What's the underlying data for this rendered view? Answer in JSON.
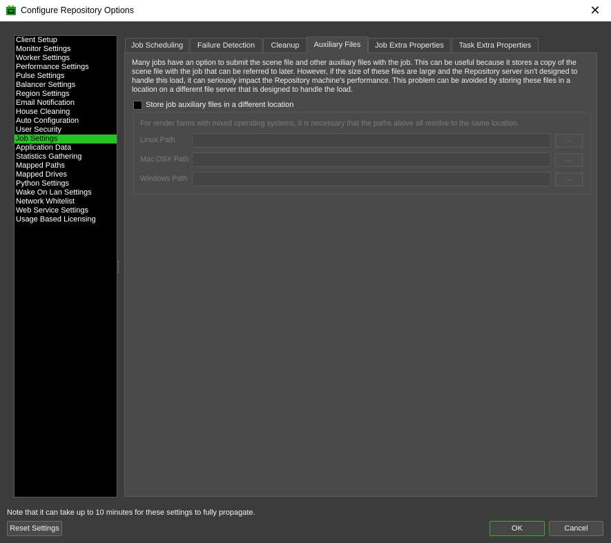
{
  "window": {
    "title": "Configure Repository Options",
    "close_glyph": "✕",
    "icon": "deadline-app-icon"
  },
  "nav": {
    "items": [
      "Client Setup",
      "Monitor Settings",
      "Worker Settings",
      "Performance Settings",
      "Pulse Settings",
      "Balancer Settings",
      "Region Settings",
      "Email Notification",
      "House Cleaning",
      "Auto Configuration",
      "User Security",
      "Job Settings",
      "Application Data",
      "Statistics Gathering",
      "Mapped Paths",
      "Mapped Drives",
      "Python Settings",
      "Wake On Lan Settings",
      "Network Whitelist",
      "Web Service Settings",
      "Usage Based Licensing"
    ],
    "selected": "Job Settings",
    "selected_color": "#22c322"
  },
  "tabs": {
    "items": [
      "Job Scheduling",
      "Failure Detection",
      "Cleanup",
      "Auxiliary Files",
      "Job Extra Properties",
      "Task Extra Properties"
    ],
    "active": "Auxiliary Files"
  },
  "aux": {
    "description": "Many jobs have an option to submit the scene file and other auxiliary files with the job. This can be useful because it stores a copy of the scene file with the job that can be referred to later. However, if the size of these files are large and the Repository server isn't designed to handle this load, it can seriously impact the Repository machine's performance. This problem can be avoided by storing these files in a location on a different file server that is designed to handle the load.",
    "store_checkbox_label": "Store job auxiliary files in a different location",
    "store_checked": false,
    "group_note": "For render farms with mixed operating systems, it is necessary that the paths above all resolve to the same location.",
    "paths": [
      {
        "label": "Linux Path",
        "value": "",
        "browse": "..."
      },
      {
        "label": "Mac OSX Path",
        "value": "",
        "browse": "..."
      },
      {
        "label": "Windows Path",
        "value": "",
        "browse": "..."
      }
    ]
  },
  "footer": {
    "note": "Note that it can take up to 10 minutes for these settings to fully propagate.",
    "reset_label": "Reset Settings",
    "ok_label": "OK",
    "cancel_label": "Cancel",
    "ok_border_color": "#2fb42f"
  }
}
